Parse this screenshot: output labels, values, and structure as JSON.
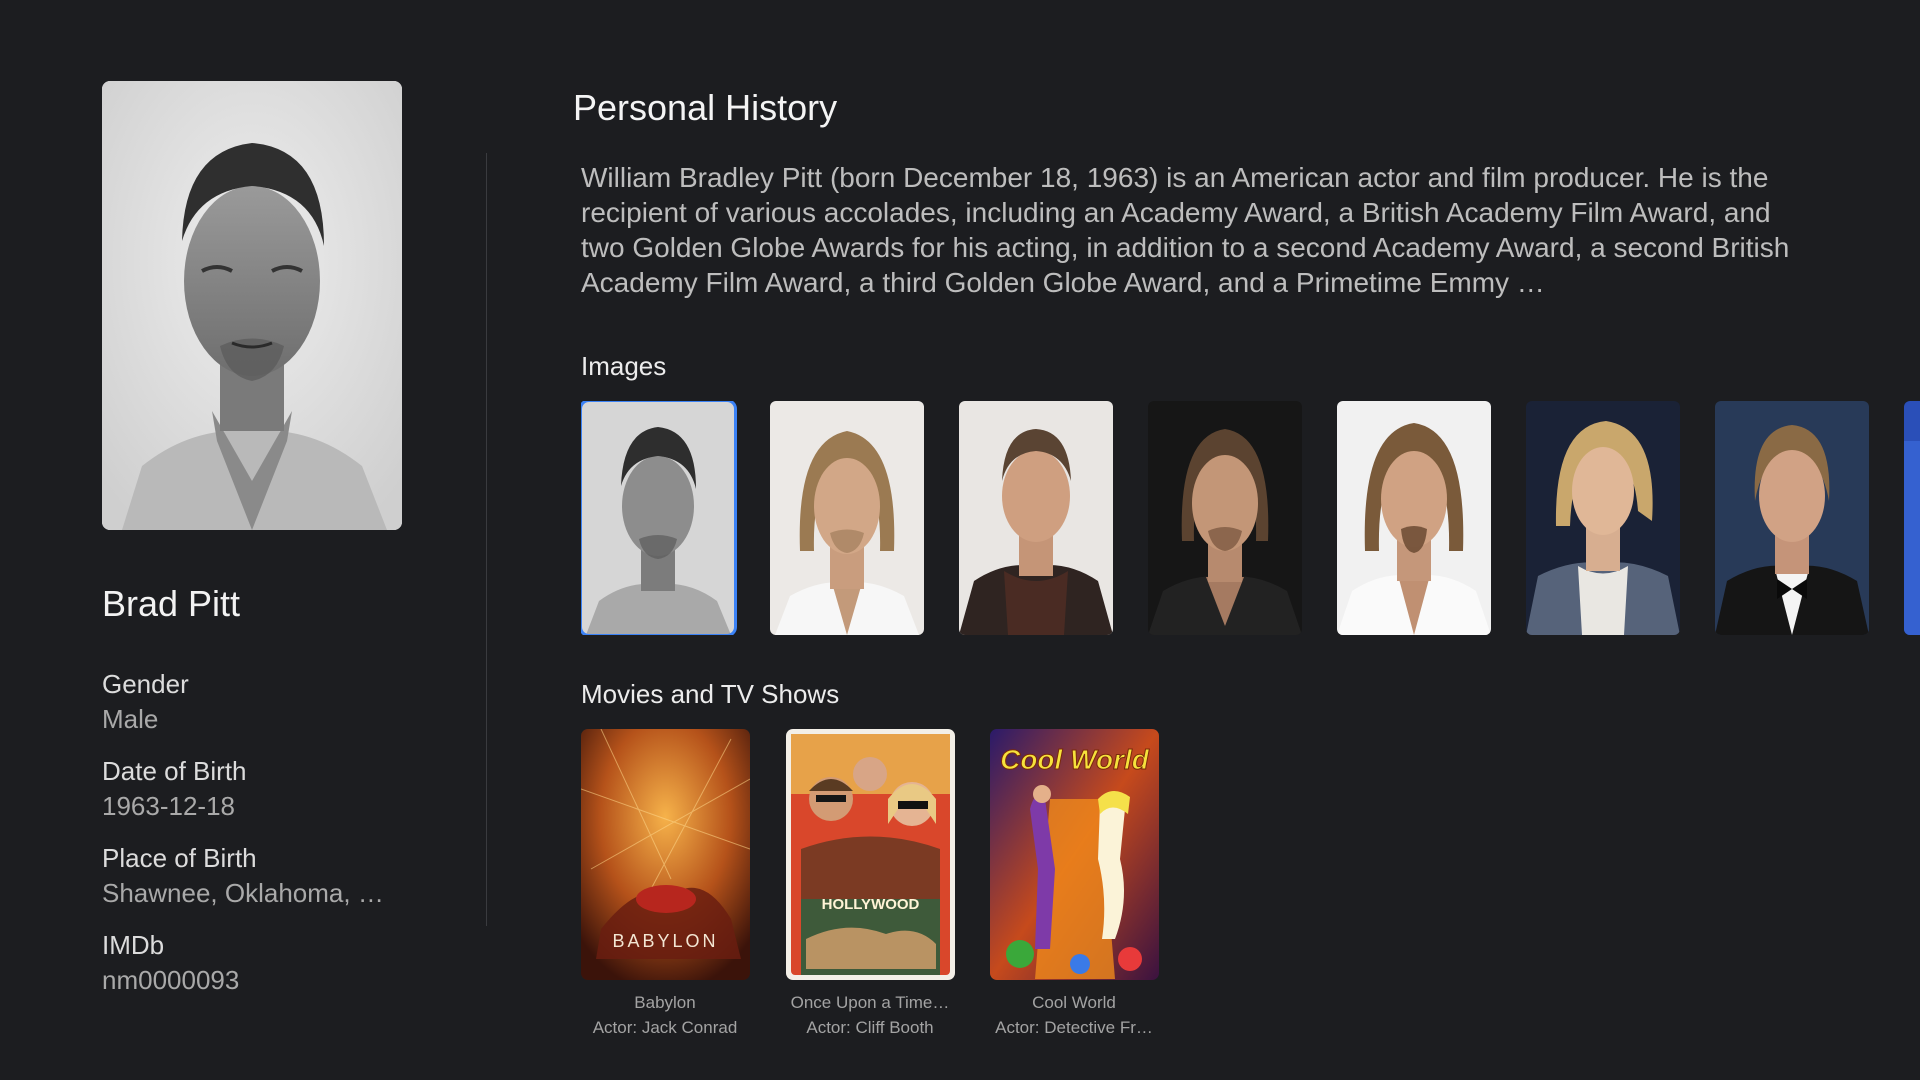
{
  "person": {
    "name": "Brad Pitt",
    "facts": [
      {
        "label": "Gender",
        "value": "Male"
      },
      {
        "label": "Date of Birth",
        "value": "1963-12-18"
      },
      {
        "label": "Place of Birth",
        "value": "Shawnee, Oklahoma, U…"
      },
      {
        "label": "IMDb",
        "value": "nm0000093"
      }
    ]
  },
  "history": {
    "title": "Personal History",
    "bio": "William Bradley Pitt (born December 18, 1963) is an American actor and film producer. He is the recipient of various accolades, including an Academy Award, a British Academy Film Award, and two Golden Globe Awards for his acting, in addition to a second Academy Award, a second British Academy Film Award, a third Golden Globe Award, and a Primetime Emmy …"
  },
  "images": {
    "heading": "Images",
    "selected_index": 0,
    "count_visible": 8
  },
  "movies": {
    "heading": "Movies and TV Shows",
    "items": [
      {
        "title": "Babylon",
        "role": "Actor: Jack Conrad",
        "poster_text": "BABYLON"
      },
      {
        "title": "Once Upon a Time…",
        "role": "Actor: Cliff Booth",
        "poster_text": "HOLLYWOOD"
      },
      {
        "title": "Cool World",
        "role": "Actor: Detective Fr…",
        "poster_text": "Cool World"
      }
    ]
  },
  "colors": {
    "background": "#1c1d20",
    "focus_outline": "#3b82f6",
    "primary_text": "#f2f2f2",
    "secondary_text": "#a9a9a9"
  }
}
